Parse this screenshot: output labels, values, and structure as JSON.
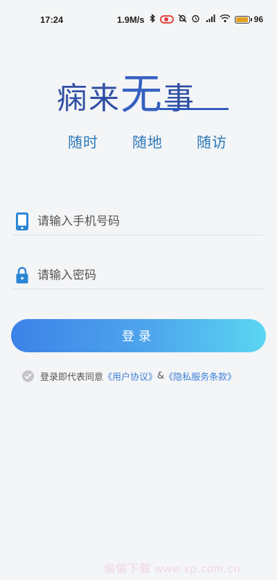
{
  "status_bar": {
    "time": "17:24",
    "net_speed": "1.9M/s",
    "battery_percent": "96",
    "battery_level": 0.96,
    "icons": [
      "bluetooth-icon",
      "record-icon",
      "mute-icon",
      "alarm-icon",
      "hd-signal-icon",
      "wifi-icon",
      "battery-icon"
    ],
    "record_color": "#e5403a",
    "battery_color": "#e0a020"
  },
  "logo": {
    "title_chars": [
      "痫",
      "来",
      "无",
      "事"
    ],
    "tagline": [
      "随时",
      "随地",
      "随访"
    ],
    "brand_color": "#2f4fa3"
  },
  "form": {
    "phone_placeholder": "请输入手机号码",
    "password_placeholder": "请输入密码",
    "phone_icon": "phone-icon",
    "lock_icon": "lock-icon",
    "icon_color": "#2a86d6"
  },
  "login": {
    "label": "登录"
  },
  "agreement": {
    "prefix": "登录即代表同意",
    "user_agreement": "《用户协议》",
    "separator": "&",
    "privacy": "《隐私服务条款》",
    "link_color": "#3b7fd6"
  },
  "watermark": "偏偏下载 www.xp.com.cn"
}
